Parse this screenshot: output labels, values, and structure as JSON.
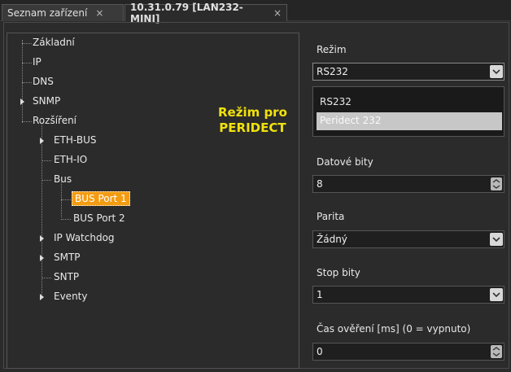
{
  "tabs": [
    {
      "label": "Seznam zařízení",
      "close": "×"
    },
    {
      "label": "10.31.0.79 [LAN232-MINI]",
      "close": "×"
    }
  ],
  "tree": {
    "zakladni": "Základní",
    "ip": "IP",
    "dns": "DNS",
    "snmp": "SNMP",
    "rozsireni": "Rozšíření",
    "eth_bus": "ETH-BUS",
    "eth_io": "ETH-IO",
    "bus": "Bus",
    "bus_port1": "BUS Port 1",
    "bus_port2": "BUS Port 2",
    "ip_watchdog": "IP Watchdog",
    "smtp": "SMTP",
    "sntp": "SNTP",
    "eventy": "Eventy"
  },
  "annotation": {
    "line1": "Režim pro",
    "line2": "PERIDECT"
  },
  "form": {
    "rezim_label": "Režim",
    "rezim_value": "RS232",
    "rezim_options": [
      "RS232",
      "Peridect 232"
    ],
    "datove_bity_label": "Datové bity",
    "datove_bity_value": "8",
    "parita_label": "Parita",
    "parita_value": "Žádný",
    "stop_bity_label": "Stop bity",
    "stop_bity_value": "1",
    "cas_label": "Čas ověření [ms] (0 = vypnuto)",
    "cas_value": "0"
  }
}
